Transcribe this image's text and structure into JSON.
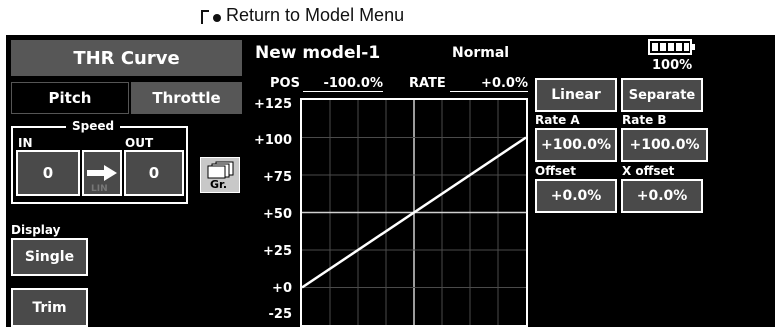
{
  "annotation": {
    "text": "Return to Model Menu"
  },
  "title": "THR Curve",
  "header": {
    "model_name": "New model-1",
    "condition": "Normal",
    "battery_percent": "100%"
  },
  "tabs": [
    {
      "label": "Pitch"
    },
    {
      "label": "Throttle",
      "selected": true
    }
  ],
  "speed": {
    "title": "Speed",
    "in_label": "IN",
    "out_label": "OUT",
    "in_value": "0",
    "out_value": "0",
    "mode_label": "LIN"
  },
  "graph_button": {
    "label": "Gr."
  },
  "display": {
    "label": "Display",
    "value": "Single"
  },
  "trim_button": {
    "label": "Trim"
  },
  "readout": {
    "pos_label": "POS",
    "pos_value": "-100.0%",
    "rate_label": "RATE",
    "rate_value": "+0.0%"
  },
  "y_ticks": [
    "+125",
    "+100",
    "+75",
    "+50",
    "+25",
    "+0",
    "-25"
  ],
  "curve": {
    "type": "Linear",
    "x_range": [
      -100,
      100
    ],
    "y_range": [
      -25,
      125
    ],
    "points": [
      {
        "x": -100,
        "y": 0
      },
      {
        "x": 100,
        "y": 100
      }
    ]
  },
  "right_panel": {
    "curve_type": "Linear",
    "mode": "Separate",
    "rate_a_label": "Rate A",
    "rate_b_label": "Rate B",
    "rate_a_value": "+100.0%",
    "rate_b_value": "+100.0%",
    "offset_label": "Offset",
    "x_offset_label": "X offset",
    "offset_value": "+0.0%",
    "x_offset_value": "+0.0%"
  }
}
